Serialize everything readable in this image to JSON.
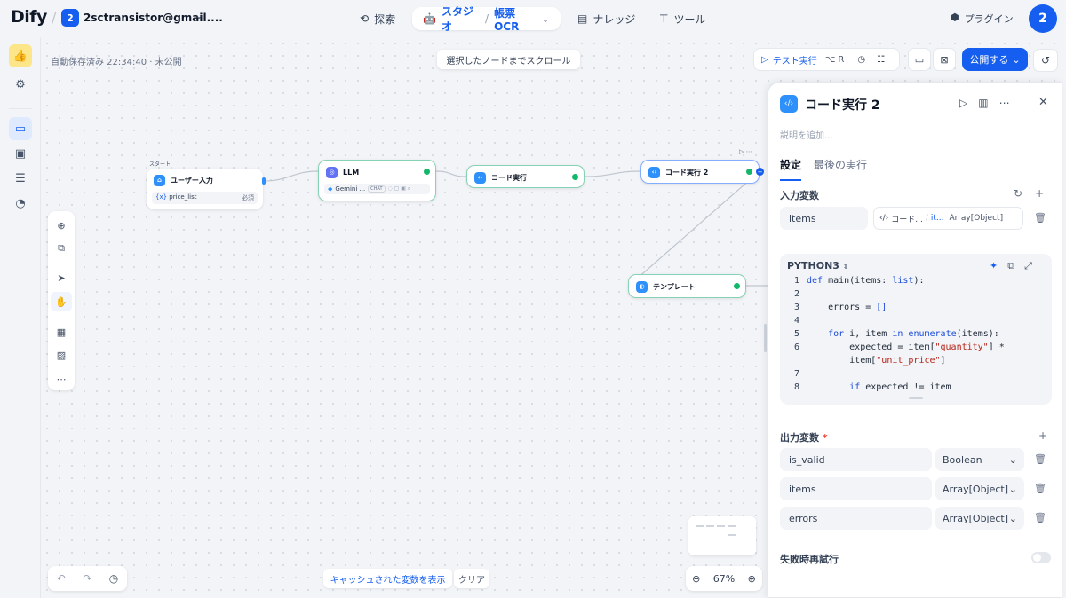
{
  "brand": {
    "logo": "Dify"
  },
  "workspace": {
    "badge": "2",
    "name": "2sctransistor@gmail...."
  },
  "nav": {
    "explore": "探索",
    "studio": "スタジオ",
    "app_name": "帳票OCR",
    "knowledge": "ナレッジ",
    "tools": "ツール"
  },
  "header_right": {
    "plugins": "プラグイン",
    "avatar": "2"
  },
  "canvas": {
    "autosave": "自動保存済み 22:34:40 · 未公開",
    "scroll_to_node": "選択したノードまでスクロール",
    "test_run": "テスト実行",
    "test_run_kbd": "⌥ R",
    "publish": "公開する",
    "show_cached_vars": "キャッシュされた変数を表示",
    "clear": "クリア",
    "zoom": "67%"
  },
  "nodes": {
    "start": {
      "tag": "スタート",
      "title": "ユーザー入力",
      "var": "price_list",
      "var_required": "必須"
    },
    "llm": {
      "title": "LLM",
      "model": "Gemini ...",
      "mode": "CHAT"
    },
    "code1": {
      "title": "コード実行"
    },
    "code2": {
      "title": "コード実行 2"
    },
    "template": {
      "title": "テンプレート"
    }
  },
  "panel": {
    "title": "コード実行 2",
    "description_placeholder": "説明を追加...",
    "tabs": [
      "設定",
      "最後の実行"
    ],
    "input_vars_title": "入力変数",
    "input_vars": [
      {
        "name": "items",
        "ref_node": "コード...",
        "ref_var": "it...",
        "ref_type": "Array[Object]"
      }
    ],
    "code_language": "PYTHON3",
    "code_lines": [
      {
        "n": "1",
        "text": "def main(items: list):"
      },
      {
        "n": "2",
        "text": ""
      },
      {
        "n": "3",
        "text": "    errors = []"
      },
      {
        "n": "4",
        "text": ""
      },
      {
        "n": "5",
        "text": "    for i, item in enumerate(items):"
      },
      {
        "n": "6",
        "text": "        expected = item[\"quantity\"] *"
      },
      {
        "n": "",
        "text": "        item[\"unit_price\"]"
      },
      {
        "n": "7",
        "text": ""
      },
      {
        "n": "8",
        "text": "        if expected != item"
      }
    ],
    "output_vars_title": "出力変数",
    "output_vars": [
      {
        "name": "is_valid",
        "type": "Boolean"
      },
      {
        "name": "items",
        "type": "Array[Object]"
      },
      {
        "name": "errors",
        "type": "Array[Object]"
      }
    ],
    "retry_title": "失敗時再試行"
  },
  "colors": {
    "accent": "#155eef",
    "success": "#12b76a",
    "node_blue": "#2e90fa",
    "llm": "#6172f3"
  }
}
